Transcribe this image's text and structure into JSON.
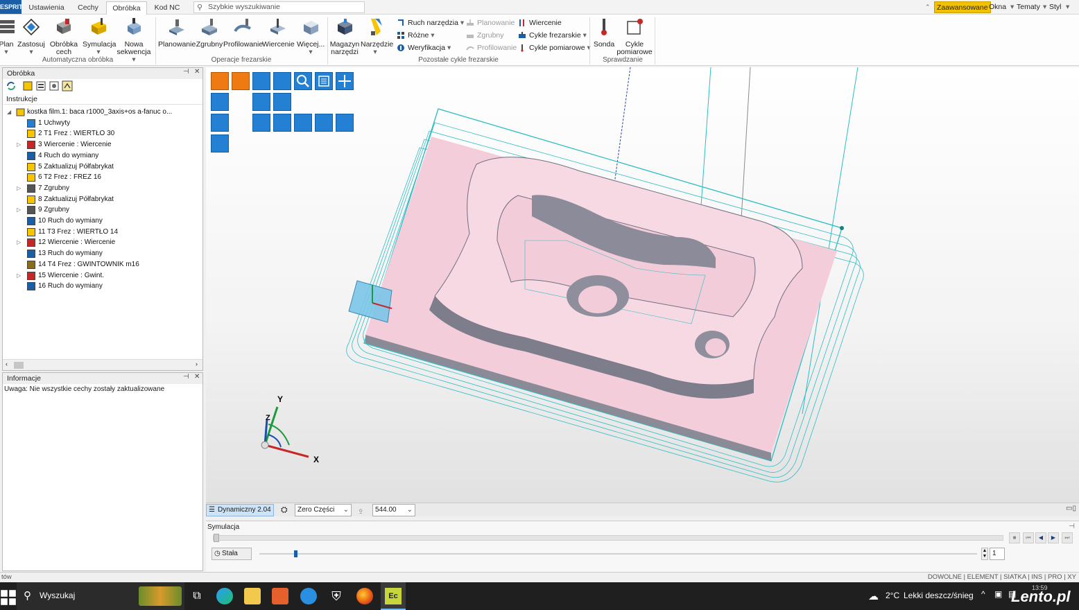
{
  "topbar": {
    "logo": "ESPRIT",
    "tabs": [
      "Ustawienia",
      "Cechy",
      "Obróbka",
      "Kod NC"
    ],
    "active_tab": "Obróbka",
    "search_placeholder": "Szybkie wyszukiwanie",
    "right": {
      "advanced": "Zaawansowane",
      "windows": "Okna",
      "themes": "Tematy",
      "style": "Styl"
    }
  },
  "ribbon": {
    "auto": {
      "plan": "Plan",
      "apply": "Zastosuj",
      "feature_machining": "Obróbka cech",
      "simulation": "Symulacja",
      "new_sequence": "Nowa sekwencja",
      "label": "Automatyczna obróbka"
    },
    "milling": {
      "facing": "Planowanie",
      "roughing": "Zgrubny",
      "profiling": "Profilowanie",
      "drilling": "Wiercenie",
      "more": "Więcej...",
      "label": "Operacje frezarskie"
    },
    "other": {
      "tool_magazine": "Magazyn narzędzi",
      "tools": "Narzędzie",
      "tool_move": "Ruch narzędzia",
      "various": "Różne",
      "verification": "Weryfikacja",
      "facing": "Planowanie",
      "roughing": "Zgrubny",
      "profiling": "Profilowanie",
      "drilling": "Wiercenie",
      "milling_cycles": "Cykle frezarskie",
      "measure_cycles": "Cykle pomiarowe",
      "label": "Pozostałe cykle frezarskie"
    },
    "check": {
      "probe": "Sonda",
      "measure_cycles": "Cykle pomiarowe",
      "label": "Sprawdzanie"
    }
  },
  "obrobka_panel": {
    "title": "Obróbka",
    "column": "Instrukcje",
    "root": "kostka film.1: baca r1000_3axis+os a-fanuc o...",
    "items": [
      {
        "label": "1 Uchwyty",
        "expandable": false
      },
      {
        "label": "2 T1 Frez : WIERTŁO 30",
        "expandable": false
      },
      {
        "label": "3 Wiercenie : Wiercenie",
        "expandable": true
      },
      {
        "label": "4 Ruch do wymiany",
        "expandable": false
      },
      {
        "label": "5 Zaktualizuj Półfabrykat",
        "expandable": false
      },
      {
        "label": "6 T2 Frez : FREZ 16",
        "expandable": false
      },
      {
        "label": "7 Zgrubny",
        "expandable": true
      },
      {
        "label": "8 Zaktualizuj Półfabrykat",
        "expandable": false
      },
      {
        "label": "9 Zgrubny",
        "expandable": true
      },
      {
        "label": "10 Ruch do wymiany",
        "expandable": false
      },
      {
        "label": "11 T3 Frez : WIERTŁO 14",
        "expandable": false
      },
      {
        "label": "12 Wiercenie : Wiercenie",
        "expandable": true
      },
      {
        "label": "13 Ruch do wymiany",
        "expandable": false
      },
      {
        "label": "14 T4 Frez : GWINTOWNIK m16",
        "expandable": false
      },
      {
        "label": "15 Wiercenie : Gwint.",
        "expandable": true
      },
      {
        "label": "16 Ruch do wymiany",
        "expandable": false
      }
    ]
  },
  "info_panel": {
    "title": "Informacje",
    "message": "Uwaga: Nie wszystkie cechy zostały zaktualizowane"
  },
  "viewport": {
    "axis_x": "X",
    "axis_y": "Y",
    "axis_z": "Z"
  },
  "statusbar": {
    "mode": "Dynamiczny 2.04",
    "zero": "Zero Części",
    "value": "544.00"
  },
  "sim": {
    "title": "Symulacja",
    "stala": "Stała",
    "step": "1",
    "slider_fraction": 0.04
  },
  "bottombar": {
    "left": "tów",
    "flags": "DOWOLNE | ELEMENT | SIATKA | INS | PRO | XY"
  },
  "taskbar": {
    "search": "Wyszukaj",
    "weather": "2°C",
    "weather_desc": "Lekki deszcz/śnieg",
    "time": "13:59",
    "brand": "Lento.pl"
  },
  "colors": {
    "accent": "#2480d3",
    "highlight": "#f2c200",
    "part": "#f3cdd9",
    "toolpath": "#2bbdc3"
  }
}
